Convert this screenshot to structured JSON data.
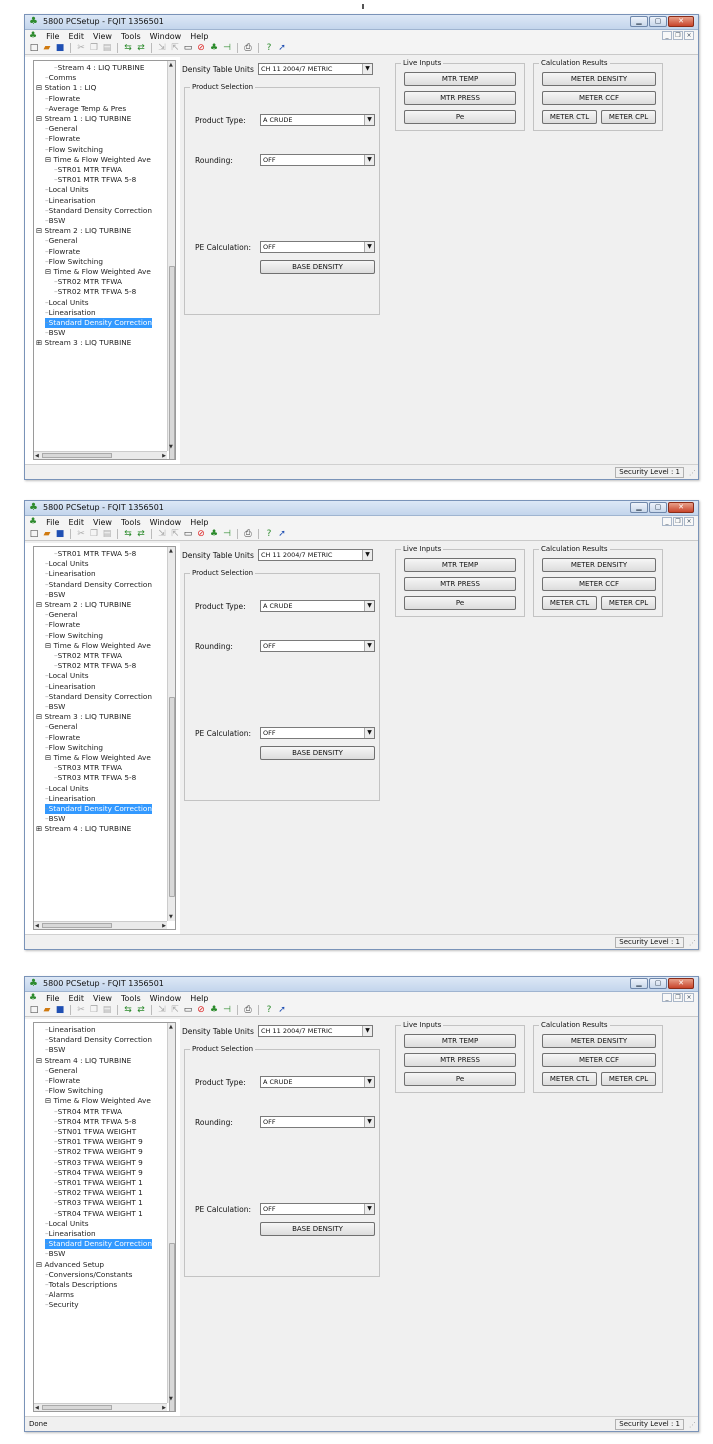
{
  "app": {
    "title": "5800 PCSetup - FQIT 1356501",
    "menus": [
      "File",
      "Edit",
      "View",
      "Tools",
      "Window",
      "Help"
    ],
    "toolbar_icons": [
      "new-icon",
      "open-icon",
      "save-icon",
      "cut-icon",
      "copy-icon",
      "paste-icon",
      "connect-icon",
      "disconnect-icon",
      "read-icon",
      "write-icon",
      "stop-icon",
      "no-icon",
      "pin-icon",
      "flag-icon",
      "print-icon",
      "help-icon",
      "pointer-icon"
    ],
    "colors": {
      "selection": "#3399ff",
      "titlebar": "#c3d5ec",
      "close_button": "#c8452b"
    }
  },
  "form": {
    "density_table_units_label": "Density Table Units",
    "density_table_units_value": "CH 11 2004/7 METRIC",
    "product_selection_title": "Product Selection",
    "product_type_label": "Product Type:",
    "product_type_value": "A CRUDE",
    "rounding_label": "Rounding:",
    "rounding_value": "OFF",
    "pe_calculation_label": "PE Calculation:",
    "pe_calculation_value": "OFF",
    "base_density_button": "BASE DENSITY",
    "live_inputs_title": "Live Inputs",
    "mtr_temp_button": "MTR TEMP",
    "mtr_press_button": "MTR PRESS",
    "pe_button": "Pe",
    "calc_results_title": "Calculation Results",
    "meter_density_button": "METER DENSITY",
    "meter_ccf_button": "METER CCF",
    "meter_ctl_button": "METER CTL",
    "meter_cpl_button": "METER CPL"
  },
  "screens": [
    {
      "status_left": "",
      "status_right": "Security Level : 1",
      "tree": [
        {
          "text": "Stream 4 : LIQ TURBINE",
          "level": 2,
          "prefix": "",
          "selected": false
        },
        {
          "text": "Comms",
          "level": 1,
          "prefix": "",
          "selected": false
        },
        {
          "text": "Station 1 : LIQ",
          "level": 0,
          "prefix": "⊟",
          "selected": false
        },
        {
          "text": "Flowrate",
          "level": 1,
          "prefix": "",
          "selected": false
        },
        {
          "text": "Average Temp & Pres",
          "level": 1,
          "prefix": "",
          "selected": false
        },
        {
          "text": "Stream 1 : LIQ TURBINE",
          "level": 0,
          "prefix": "⊟",
          "selected": false
        },
        {
          "text": "General",
          "level": 1,
          "prefix": "",
          "selected": false
        },
        {
          "text": "Flowrate",
          "level": 1,
          "prefix": "",
          "selected": false
        },
        {
          "text": "Flow Switching",
          "level": 1,
          "prefix": "",
          "selected": false
        },
        {
          "text": "Time & Flow Weighted Ave",
          "level": 1,
          "prefix": "⊟",
          "selected": false
        },
        {
          "text": "STR01 MTR TFWA",
          "level": 2,
          "prefix": "",
          "selected": false
        },
        {
          "text": "STR01 MTR TFWA 5-8",
          "level": 2,
          "prefix": "",
          "selected": false
        },
        {
          "text": "Local Units",
          "level": 1,
          "prefix": "",
          "selected": false
        },
        {
          "text": "Linearisation",
          "level": 1,
          "prefix": "",
          "selected": false
        },
        {
          "text": "Standard Density Correction",
          "level": 1,
          "prefix": "",
          "selected": false
        },
        {
          "text": "BSW",
          "level": 1,
          "prefix": "",
          "selected": false
        },
        {
          "text": "Stream 2 : LIQ TURBINE",
          "level": 0,
          "prefix": "⊟",
          "selected": false
        },
        {
          "text": "General",
          "level": 1,
          "prefix": "",
          "selected": false
        },
        {
          "text": "Flowrate",
          "level": 1,
          "prefix": "",
          "selected": false
        },
        {
          "text": "Flow Switching",
          "level": 1,
          "prefix": "",
          "selected": false
        },
        {
          "text": "Time & Flow Weighted Ave",
          "level": 1,
          "prefix": "⊟",
          "selected": false
        },
        {
          "text": "STR02 MTR TFWA",
          "level": 2,
          "prefix": "",
          "selected": false
        },
        {
          "text": "STR02 MTR TFWA 5-8",
          "level": 2,
          "prefix": "",
          "selected": false
        },
        {
          "text": "Local Units",
          "level": 1,
          "prefix": "",
          "selected": false
        },
        {
          "text": "Linearisation",
          "level": 1,
          "prefix": "",
          "selected": false
        },
        {
          "text": "Standard Density Correction",
          "level": 1,
          "prefix": "",
          "selected": true
        },
        {
          "text": "BSW",
          "level": 1,
          "prefix": "",
          "selected": false
        },
        {
          "text": "Stream 3 : LIQ TURBINE",
          "level": 0,
          "prefix": "⊞",
          "selected": false
        }
      ]
    },
    {
      "status_left": "",
      "status_right": "Security Level : 1",
      "tree": [
        {
          "text": "STR01 MTR TFWA 5-8",
          "level": 2,
          "prefix": "",
          "selected": false
        },
        {
          "text": "Local Units",
          "level": 1,
          "prefix": "",
          "selected": false
        },
        {
          "text": "Linearisation",
          "level": 1,
          "prefix": "",
          "selected": false
        },
        {
          "text": "Standard Density Correction",
          "level": 1,
          "prefix": "",
          "selected": false
        },
        {
          "text": "BSW",
          "level": 1,
          "prefix": "",
          "selected": false
        },
        {
          "text": "Stream 2 : LIQ TURBINE",
          "level": 0,
          "prefix": "⊟",
          "selected": false
        },
        {
          "text": "General",
          "level": 1,
          "prefix": "",
          "selected": false
        },
        {
          "text": "Flowrate",
          "level": 1,
          "prefix": "",
          "selected": false
        },
        {
          "text": "Flow Switching",
          "level": 1,
          "prefix": "",
          "selected": false
        },
        {
          "text": "Time & Flow Weighted Ave",
          "level": 1,
          "prefix": "⊟",
          "selected": false
        },
        {
          "text": "STR02 MTR TFWA",
          "level": 2,
          "prefix": "",
          "selected": false
        },
        {
          "text": "STR02 MTR TFWA 5-8",
          "level": 2,
          "prefix": "",
          "selected": false
        },
        {
          "text": "Local Units",
          "level": 1,
          "prefix": "",
          "selected": false
        },
        {
          "text": "Linearisation",
          "level": 1,
          "prefix": "",
          "selected": false
        },
        {
          "text": "Standard Density Correction",
          "level": 1,
          "prefix": "",
          "selected": false
        },
        {
          "text": "BSW",
          "level": 1,
          "prefix": "",
          "selected": false
        },
        {
          "text": "Stream 3 : LIQ TURBINE",
          "level": 0,
          "prefix": "⊟",
          "selected": false
        },
        {
          "text": "General",
          "level": 1,
          "prefix": "",
          "selected": false
        },
        {
          "text": "Flowrate",
          "level": 1,
          "prefix": "",
          "selected": false
        },
        {
          "text": "Flow Switching",
          "level": 1,
          "prefix": "",
          "selected": false
        },
        {
          "text": "Time & Flow Weighted Ave",
          "level": 1,
          "prefix": "⊟",
          "selected": false
        },
        {
          "text": "STR03 MTR TFWA",
          "level": 2,
          "prefix": "",
          "selected": false
        },
        {
          "text": "STR03 MTR TFWA 5-8",
          "level": 2,
          "prefix": "",
          "selected": false
        },
        {
          "text": "Local Units",
          "level": 1,
          "prefix": "",
          "selected": false
        },
        {
          "text": "Linearisation",
          "level": 1,
          "prefix": "",
          "selected": false
        },
        {
          "text": "Standard Density Correction",
          "level": 1,
          "prefix": "",
          "selected": true
        },
        {
          "text": "BSW",
          "level": 1,
          "prefix": "",
          "selected": false
        },
        {
          "text": "Stream 4 : LIQ TURBINE",
          "level": 0,
          "prefix": "⊞",
          "selected": false
        }
      ]
    },
    {
      "status_left": "Done",
      "status_right": "Security Level : 1",
      "tree": [
        {
          "text": "Linearisation",
          "level": 1,
          "prefix": "",
          "selected": false
        },
        {
          "text": "Standard Density Correction",
          "level": 1,
          "prefix": "",
          "selected": false
        },
        {
          "text": "BSW",
          "level": 1,
          "prefix": "",
          "selected": false
        },
        {
          "text": "Stream 4 : LIQ TURBINE",
          "level": 0,
          "prefix": "⊟",
          "selected": false
        },
        {
          "text": "General",
          "level": 1,
          "prefix": "",
          "selected": false
        },
        {
          "text": "Flowrate",
          "level": 1,
          "prefix": "",
          "selected": false
        },
        {
          "text": "Flow Switching",
          "level": 1,
          "prefix": "",
          "selected": false
        },
        {
          "text": "Time & Flow Weighted Ave",
          "level": 1,
          "prefix": "⊟",
          "selected": false
        },
        {
          "text": "STR04 MTR TFWA",
          "level": 2,
          "prefix": "",
          "selected": false
        },
        {
          "text": "STR04 MTR TFWA 5-8",
          "level": 2,
          "prefix": "",
          "selected": false
        },
        {
          "text": "STN01 TFWA WEIGHT",
          "level": 2,
          "prefix": "",
          "selected": false
        },
        {
          "text": "STR01 TFWA WEIGHT 9",
          "level": 2,
          "prefix": "",
          "selected": false
        },
        {
          "text": "STR02 TFWA WEIGHT 9",
          "level": 2,
          "prefix": "",
          "selected": false
        },
        {
          "text": "STR03 TFWA WEIGHT 9",
          "level": 2,
          "prefix": "",
          "selected": false
        },
        {
          "text": "STR04 TFWA WEIGHT 9",
          "level": 2,
          "prefix": "",
          "selected": false
        },
        {
          "text": "STR01 TFWA WEIGHT 1",
          "level": 2,
          "prefix": "",
          "selected": false
        },
        {
          "text": "STR02 TFWA WEIGHT 1",
          "level": 2,
          "prefix": "",
          "selected": false
        },
        {
          "text": "STR03 TFWA WEIGHT 1",
          "level": 2,
          "prefix": "",
          "selected": false
        },
        {
          "text": "STR04 TFWA WEIGHT 1",
          "level": 2,
          "prefix": "",
          "selected": false
        },
        {
          "text": "Local Units",
          "level": 1,
          "prefix": "",
          "selected": false
        },
        {
          "text": "Linearisation",
          "level": 1,
          "prefix": "",
          "selected": false
        },
        {
          "text": "Standard Density Correction",
          "level": 1,
          "prefix": "",
          "selected": true
        },
        {
          "text": "BSW",
          "level": 1,
          "prefix": "",
          "selected": false
        },
        {
          "text": "Advanced Setup",
          "level": 0,
          "prefix": "⊟",
          "selected": false
        },
        {
          "text": "Conversions/Constants",
          "level": 1,
          "prefix": "",
          "selected": false
        },
        {
          "text": "Totals Descriptions",
          "level": 1,
          "prefix": "",
          "selected": false
        },
        {
          "text": "Alarms",
          "level": 1,
          "prefix": "",
          "selected": false
        },
        {
          "text": "Security",
          "level": 1,
          "prefix": "",
          "selected": false
        }
      ]
    }
  ]
}
